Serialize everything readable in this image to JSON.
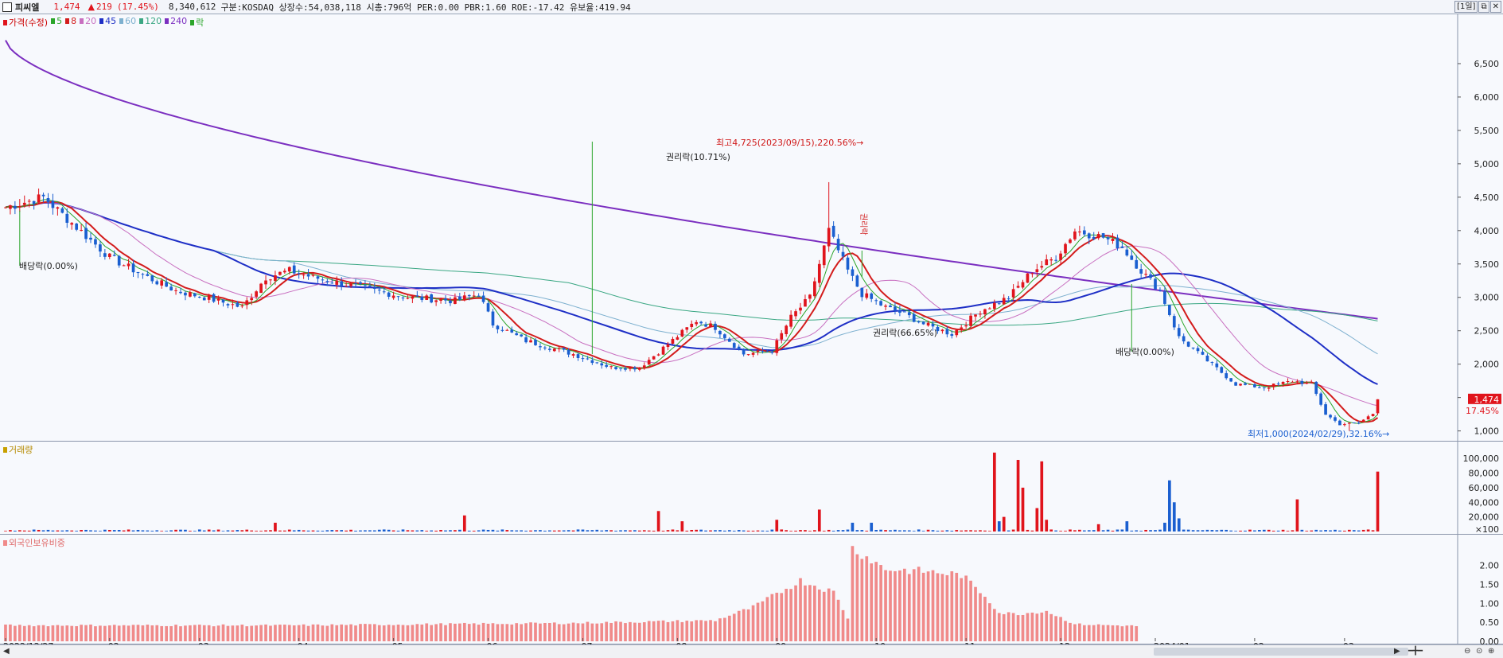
{
  "header": {
    "name": "피씨엘",
    "price": "1,474",
    "change_arrow": "▲",
    "change": "219",
    "change_pct": "(17.45%)",
    "volume": "8,340,612",
    "info": "구분:KOSDAQ 상장수:54,038,118 시총:796억 PER:0.00 PBR:1.60 ROE:-17.42 유보율:419.94",
    "period_button": "[1일]",
    "btn_restore": "⧉",
    "btn_close": "✕"
  },
  "legend": {
    "price": "가격(수정)",
    "ma5": "5",
    "ma8": "8",
    "ma20": "20",
    "ma45": "45",
    "ma60": "60",
    "ma120": "120",
    "ma240": "240",
    "event": "락"
  },
  "colors": {
    "up": "#e0141c",
    "down": "#1a5fd0",
    "ma5": "#2aa52a",
    "ma8": "#d31c1c",
    "ma20": "#c86fc0",
    "ma45": "#1e2fc6",
    "ma60": "#7db0cf",
    "ma120": "#3aa783",
    "ma240": "#7b2fc0",
    "foreign": "#f08a8a"
  },
  "volume_panel": {
    "title": "거래량"
  },
  "foreign_panel": {
    "title": "외국인보유비중"
  },
  "annotations": {
    "high": "최고4,725(2023/09/15),220.56%→",
    "low": "최저1,000(2024/02/29),32.16%→",
    "dividend1": "배당락(0.00%)",
    "rights1": "권리락(10.71%)",
    "rights2": "권리락(66.65%)",
    "dividend2": "배당락(0.00%)",
    "vertical_rights": "권리락",
    "price_tag": "1,474",
    "price_tag_pct": "17.45%"
  },
  "chart_data": [
    {
      "type": "line",
      "title": "가격(수정)",
      "y_ticks": [
        "6,500",
        "6,000",
        "5,500",
        "5,000",
        "4,500",
        "4,000",
        "3,500",
        "3,000",
        "2,500",
        "2,000",
        "1,500",
        "1,000"
      ],
      "ylim": [
        900,
        7000
      ],
      "x_ticks": [
        "2022/12/27",
        "02",
        "03",
        "04",
        "05",
        "06",
        "07",
        "08",
        "09",
        "10",
        "11",
        "12",
        "2024/01",
        "02",
        "03"
      ],
      "x_tick_index": [
        0,
        22,
        41,
        62,
        82,
        102,
        122,
        142,
        163,
        184,
        203,
        223,
        243,
        264,
        283
      ],
      "n": 300,
      "close_anchors": [
        [
          0,
          4350
        ],
        [
          8,
          4500
        ],
        [
          15,
          4050
        ],
        [
          22,
          3600
        ],
        [
          30,
          3300
        ],
        [
          36,
          3100
        ],
        [
          42,
          3000
        ],
        [
          50,
          2850
        ],
        [
          55,
          3300
        ],
        [
          60,
          3400
        ],
        [
          65,
          3300
        ],
        [
          75,
          3150
        ],
        [
          85,
          3000
        ],
        [
          95,
          2950
        ],
        [
          100,
          3050
        ],
        [
          103,
          2600
        ],
        [
          110,
          2350
        ],
        [
          120,
          2150
        ],
        [
          128,
          1950
        ],
        [
          134,
          1950
        ],
        [
          140,
          2300
        ],
        [
          146,
          2650
        ],
        [
          150,
          2550
        ],
        [
          156,
          2150
        ],
        [
          162,
          2200
        ],
        [
          166,
          2700
        ],
        [
          170,
          3000
        ],
        [
          174,
          4000
        ],
        [
          178,
          3400
        ],
        [
          181,
          3050
        ],
        [
          186,
          2850
        ],
        [
          190,
          2750
        ],
        [
          194,
          2600
        ],
        [
          200,
          2450
        ],
        [
          206,
          2800
        ],
        [
          212,
          3000
        ],
        [
          217,
          3400
        ],
        [
          222,
          3600
        ],
        [
          226,
          4000
        ],
        [
          232,
          3900
        ],
        [
          236,
          3750
        ],
        [
          240,
          3400
        ],
        [
          244,
          3100
        ],
        [
          248,
          2400
        ],
        [
          254,
          2050
        ],
        [
          260,
          1700
        ],
        [
          266,
          1650
        ],
        [
          272,
          1750
        ],
        [
          276,
          1700
        ],
        [
          279,
          1250
        ],
        [
          282,
          1100
        ],
        [
          286,
          1120
        ],
        [
          289,
          1260
        ],
        [
          290,
          1474
        ]
      ],
      "volume_spikes": [
        [
          57,
          12000
        ],
        [
          97,
          22000
        ],
        [
          138,
          28000
        ],
        [
          143,
          14000
        ],
        [
          163,
          16000
        ],
        [
          172,
          30000
        ],
        [
          179,
          12000
        ],
        [
          183,
          12000
        ],
        [
          209,
          108000
        ],
        [
          210,
          14000
        ],
        [
          211,
          20000
        ],
        [
          214,
          98000
        ],
        [
          215,
          60000
        ],
        [
          218,
          32000
        ],
        [
          219,
          96000
        ],
        [
          220,
          16000
        ],
        [
          231,
          10000
        ],
        [
          237,
          14000
        ],
        [
          245,
          12000
        ],
        [
          246,
          70000
        ],
        [
          247,
          40000
        ],
        [
          248,
          18000
        ],
        [
          273,
          44000
        ],
        [
          290,
          82000
        ]
      ],
      "volume_ticks": [
        "100,000",
        "80,000",
        "60,000",
        "40,000",
        "20,000",
        "×100"
      ],
      "foreign_anchors": [
        [
          0,
          0.42
        ],
        [
          60,
          0.42
        ],
        [
          120,
          0.48
        ],
        [
          150,
          0.55
        ],
        [
          158,
          0.9
        ],
        [
          168,
          1.6
        ],
        [
          175,
          1.3
        ],
        [
          178,
          0.62
        ],
        [
          179,
          2.45
        ],
        [
          183,
          2.15
        ],
        [
          186,
          1.9
        ],
        [
          194,
          1.85
        ],
        [
          202,
          1.75
        ],
        [
          207,
          1.2
        ],
        [
          210,
          0.75
        ],
        [
          214,
          0.72
        ],
        [
          220,
          0.8
        ],
        [
          226,
          0.45
        ],
        [
          240,
          0.4
        ],
        [
          241,
          null
        ]
      ],
      "foreign_ticks": [
        "2.00",
        "1.50",
        "1.00",
        "0.50",
        "0.00"
      ]
    }
  ]
}
